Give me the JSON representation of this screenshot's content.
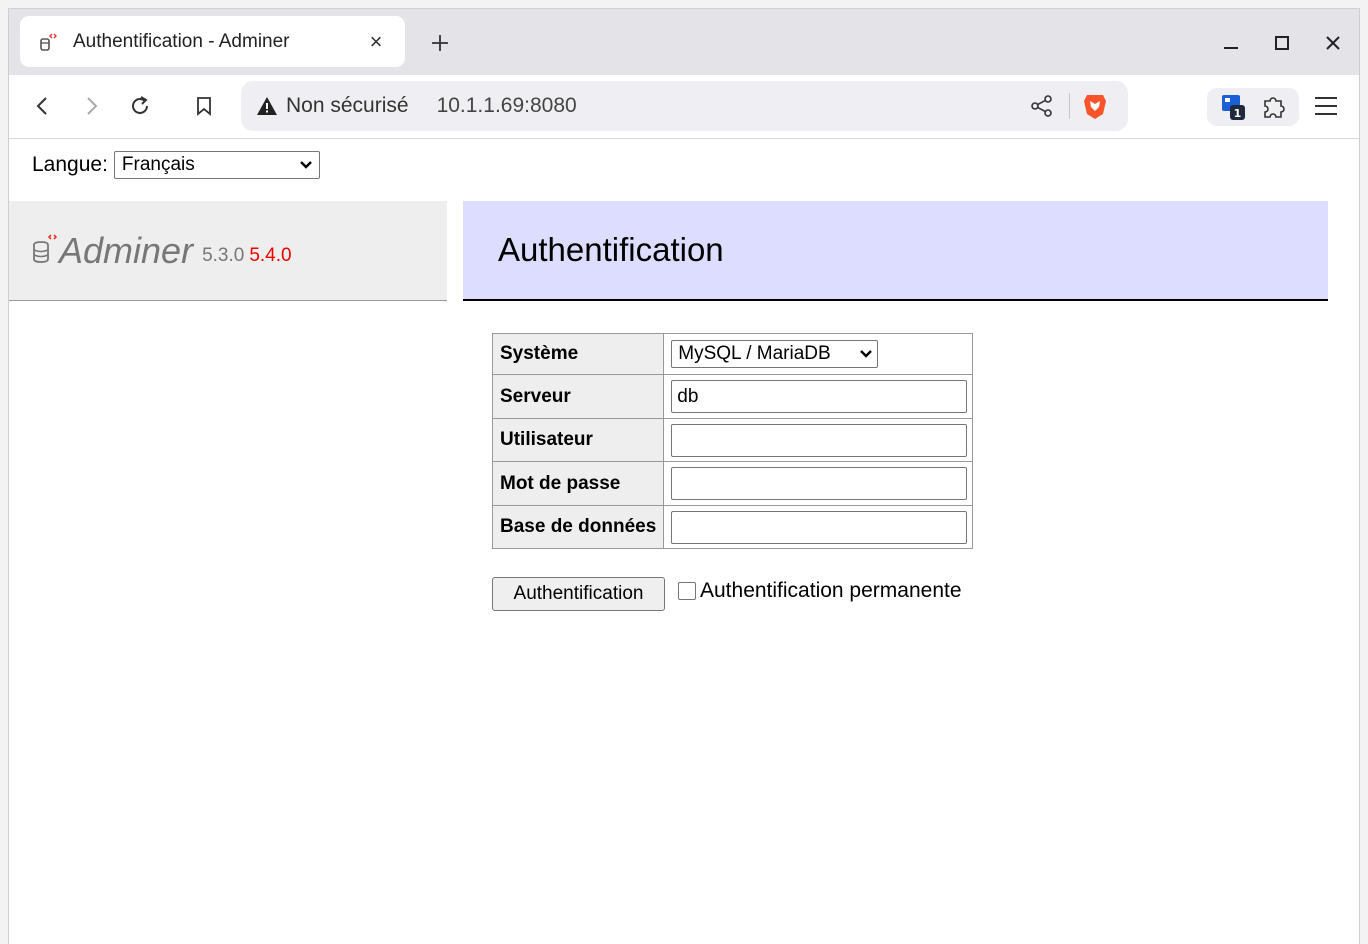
{
  "browser": {
    "tab": {
      "title": "Authentification - Adminer",
      "close_label": "×"
    },
    "newtab_label": "+",
    "omnibox": {
      "security_label": "Non sécurisé",
      "url": "10.1.1.69:8080"
    },
    "extension_badge": "1"
  },
  "page": {
    "language": {
      "label": "Langue:",
      "selected": "Français"
    },
    "logo": {
      "name": "Adminer",
      "version": "5.3.0",
      "new_version": "5.4.0"
    },
    "heading": "Authentification",
    "form": {
      "rows": [
        {
          "label": "Système",
          "type": "select",
          "value": "MySQL / MariaDB"
        },
        {
          "label": "Serveur",
          "type": "input",
          "value": "db"
        },
        {
          "label": "Utilisateur",
          "type": "input",
          "value": ""
        },
        {
          "label": "Mot de passe",
          "type": "input",
          "value": ""
        },
        {
          "label": "Base de données",
          "type": "input",
          "value": ""
        }
      ],
      "submit_label": "Authentification",
      "permanent_label": "Authentification permanente"
    }
  },
  "colors": {
    "content_header_bg": "#ddddff",
    "menu_bg": "#eeeeee",
    "new_version": "#ee0000",
    "brave_shield": "#fb542b",
    "extension_blue": "#1a5fd6"
  }
}
